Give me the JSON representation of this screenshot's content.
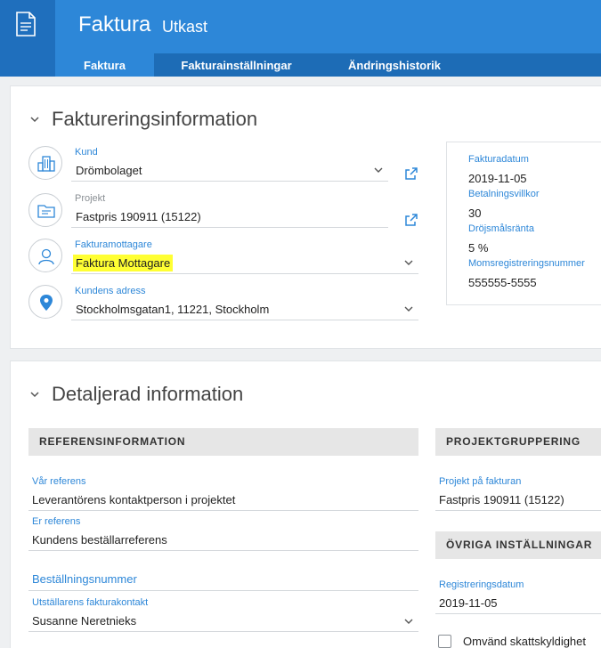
{
  "header": {
    "title": "Faktura",
    "status": "Utkast",
    "tabs": [
      {
        "label": "Faktura",
        "active": true
      },
      {
        "label": "Fakturainställningar",
        "active": false
      },
      {
        "label": "Ändringshistorik",
        "active": false
      }
    ]
  },
  "billing": {
    "heading": "Faktureringsinformation",
    "fields": [
      {
        "label": "Kund",
        "value": "Drömbolaget",
        "icon": "building-icon"
      },
      {
        "label": "Projekt",
        "value": "Fastpris 190911 (15122)",
        "icon": "project-folder-icon"
      },
      {
        "label": "Fakturamottagare",
        "value": "Faktura Mottagare",
        "icon": "person-icon"
      },
      {
        "label": "Kundens adress",
        "value": "Stockholmsgatan1, 11221, Stockholm",
        "icon": "location-pin-icon"
      }
    ],
    "info": [
      {
        "label": "Fakturadatum",
        "value": "2019-11-05"
      },
      {
        "label": "Betalningsvillkor",
        "value": "30"
      },
      {
        "label": "Dröjsmålsränta",
        "value": "5 %"
      },
      {
        "label": "Momsregistreringsnummer",
        "value": "555555-5555"
      }
    ]
  },
  "details": {
    "heading": "Detaljerad information",
    "reference": {
      "title": "REFERENSINFORMATION",
      "our_ref_label": "Vår referens",
      "our_ref_value": "Leverantörens kontaktperson i projektet",
      "their_ref_label": "Er referens",
      "their_ref_value": "Kundens beställarreferens",
      "order_number_label": "Beställningsnummer",
      "issuer_contact_label": "Utställarens fakturakontakt",
      "issuer_contact_value": "Susanne Neretnieks"
    },
    "project_grouping": {
      "title": "PROJEKTGRUPPERING",
      "project_label": "Projekt på fakturan",
      "project_value": "Fastpris 190911 (15122)"
    },
    "other_settings": {
      "title": "ÖVRIGA INSTÄLLNINGAR",
      "reg_date_label": "Registreringsdatum",
      "reg_date_value": "2019-11-05",
      "reverse_vat_label": "Omvänd skattskyldighet",
      "reverse_vat_checked": false
    }
  },
  "colors": {
    "accent": "#2d87d8",
    "header_dark": "#1d6cb6",
    "highlight": "#ffff33"
  }
}
